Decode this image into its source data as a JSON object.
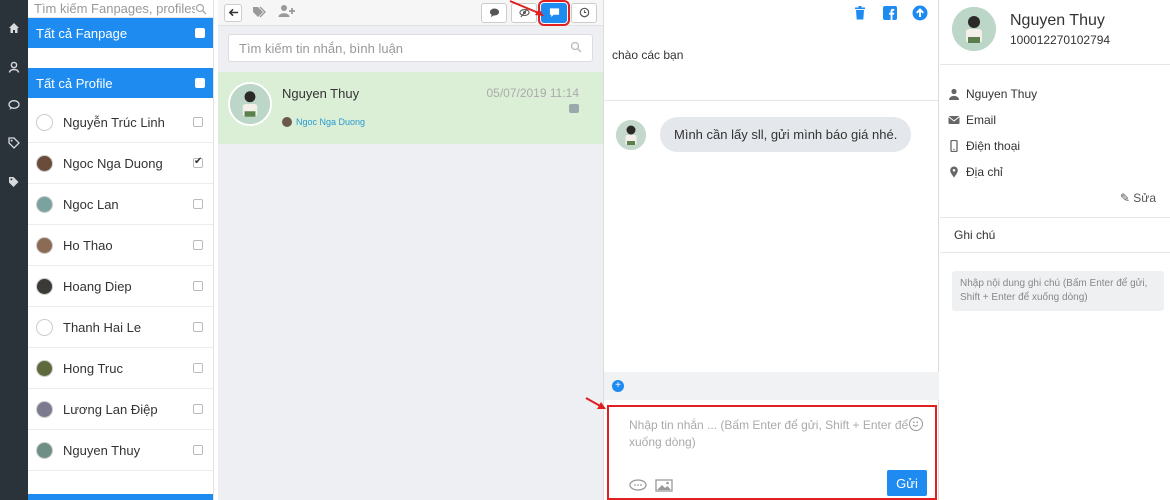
{
  "rail": {
    "icons": [
      "home-icon",
      "user-icon",
      "comment-icon",
      "tag-icon",
      "tags-icon"
    ]
  },
  "profile_list": {
    "search_placeholder": "Tìm kiếm Fanpages, profiles",
    "group_fanpage": "Tất cả Fanpage",
    "group_profile": "Tất cả Profile",
    "items": [
      {
        "name": "Nguyễn Trúc Linh",
        "checked": false,
        "avatar_color": "#ffffff"
      },
      {
        "name": "Ngoc Nga Duong",
        "checked": true,
        "avatar_color": "#6b4c3b"
      },
      {
        "name": "Ngoc Lan",
        "checked": false,
        "avatar_color": "#7aa3a0"
      },
      {
        "name": "Ho Thao",
        "checked": false,
        "avatar_color": "#8b6b53"
      },
      {
        "name": "Hoang Diep",
        "checked": false,
        "avatar_color": "#3b3a36"
      },
      {
        "name": "Thanh Hai Le",
        "checked": false,
        "avatar_color": "#ffffff"
      },
      {
        "name": "Hong Truc",
        "checked": false,
        "avatar_color": "#5f6a3c"
      },
      {
        "name": "Lương Lan Điệp",
        "checked": false,
        "avatar_color": "#7b7a8f"
      },
      {
        "name": "Nguyen Thuy",
        "checked": false,
        "avatar_color": "#6f8f86"
      }
    ]
  },
  "conversations": {
    "search_placeholder": "Tìm kiếm tin nhắn, bình luận",
    "items": [
      {
        "name": "Nguyen Thuy",
        "date": "05/07/2019 11:14",
        "page": "Ngoc Nga Duong"
      }
    ]
  },
  "chat": {
    "title": "chào các bạn",
    "messages": [
      {
        "text": "Mình cần lấy sll, gửi mình báo giá nhé."
      }
    ],
    "composer_placeholder": "Nhập tin nhắn ... (Bấm Enter để gửi, Shift + Enter để xuống dòng)",
    "send_label": "Gửi"
  },
  "profile": {
    "name": "Nguyen Thuy",
    "id": "100012270102794",
    "fields": {
      "name": "Nguyen Thuy",
      "email": "Email",
      "phone": "Điện thoại",
      "address": "Địa chỉ"
    },
    "edit_label": "Sửa",
    "note_title": "Ghi chú",
    "note_placeholder": "Nhập nội dung ghi chú (Bấm Enter để gửi, Shift + Enter để xuống dòng)"
  },
  "colors": {
    "accent": "#1e8bf1",
    "highlight_border": "#e02020",
    "selected_conversation": "#dbefd6",
    "rail": "#2b333a"
  }
}
